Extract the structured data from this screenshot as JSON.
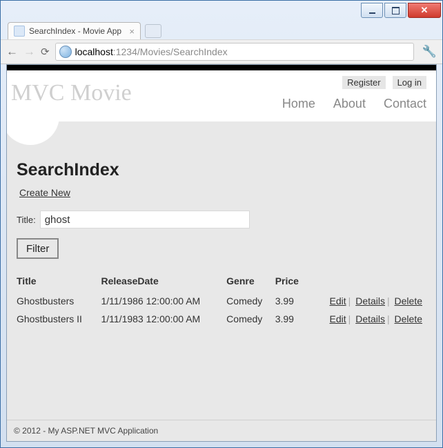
{
  "window": {
    "tab_title": "SearchIndex - Movie App",
    "url_host": "localhost",
    "url_port": ":1234",
    "url_path": "/Movies/SearchIndex"
  },
  "header": {
    "brand": "MVC Movie",
    "account": {
      "register": "Register",
      "login": "Log in"
    },
    "nav": {
      "home": "Home",
      "about": "About",
      "contact": "Contact"
    }
  },
  "page": {
    "heading": "SearchIndex",
    "create_link": "Create New",
    "title_label": "Title:",
    "title_value": "ghost",
    "filter_label": "Filter"
  },
  "table": {
    "headers": {
      "title": "Title",
      "release": "ReleaseDate",
      "genre": "Genre",
      "price": "Price"
    },
    "actions": {
      "edit": "Edit",
      "details": "Details",
      "delete": "Delete"
    },
    "rows": [
      {
        "title": "Ghostbusters",
        "release": "1/11/1986 12:00:00 AM",
        "genre": "Comedy",
        "price": "3.99"
      },
      {
        "title": "Ghostbusters II",
        "release": "1/11/1983 12:00:00 AM",
        "genre": "Comedy",
        "price": "3.99"
      }
    ]
  },
  "footer": {
    "text": "© 2012 - My ASP.NET MVC Application"
  }
}
